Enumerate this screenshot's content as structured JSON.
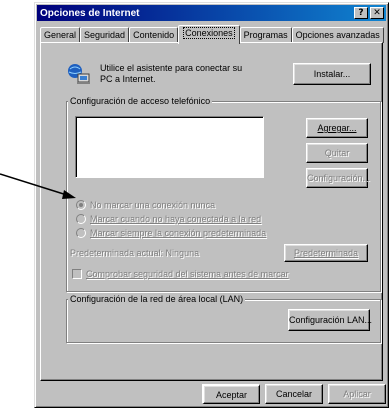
{
  "window": {
    "title": "Opciones de Internet",
    "help_glyph": "?",
    "close_glyph": "✕"
  },
  "tabs": [
    {
      "label": "General"
    },
    {
      "label": "Seguridad"
    },
    {
      "label": "Contenido"
    },
    {
      "label": "Conexiones"
    },
    {
      "label": "Programas"
    },
    {
      "label": "Opciones avanzadas"
    }
  ],
  "active_tab": "Conexiones",
  "wizard": {
    "text": "Utilice el asistente para conectar su PC a Internet.",
    "install_label": "Instalar..."
  },
  "dialup": {
    "group_label": "Configuración de acceso telefónico",
    "add_label": "Agregar...",
    "remove_label": "Quitar",
    "settings_label": "Configuración...",
    "options": [
      {
        "label": "No marcar una conexión nunca",
        "checked": true
      },
      {
        "label": "Marcar cuando no haya conectada a la red",
        "checked": false
      },
      {
        "label": "Marcar siempre la conexión predeterminada",
        "checked": false
      }
    ],
    "default_text": "Predeterminada actual:  Ninguna",
    "set_default_label": "Predeterminada",
    "check_security_label": "Comprobar seguridad del sistema antes de marcar"
  },
  "lan": {
    "group_label": "Configuración de la red de área local (LAN)",
    "settings_label": "Configuración LAN..."
  },
  "footer": {
    "ok_label": "Aceptar",
    "cancel_label": "Cancelar",
    "apply_label": "Aplicar"
  },
  "colors": {
    "titlebar_start": "#00007b",
    "titlebar_end": "#1084d0",
    "face": "#c0c0c0",
    "disabled_text": "#808080"
  }
}
